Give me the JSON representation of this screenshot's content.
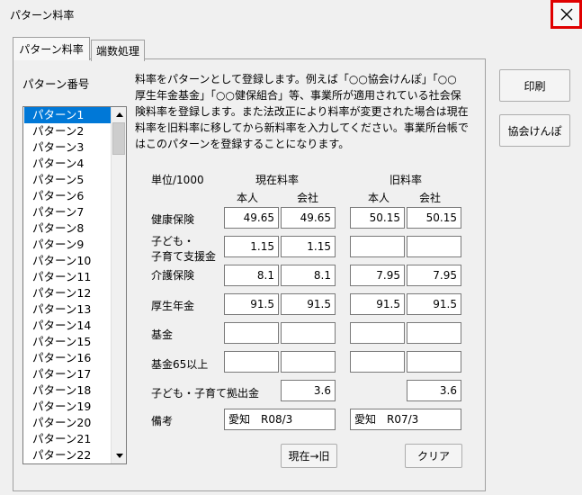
{
  "window": {
    "title": "パターン料率"
  },
  "tabs": [
    {
      "label": "パターン料率"
    },
    {
      "label": "端数処理"
    }
  ],
  "pattern_list": {
    "label": "パターン番号",
    "items": [
      "パターン1",
      "パターン2",
      "パターン3",
      "パターン4",
      "パターン5",
      "パターン6",
      "パターン7",
      "パターン8",
      "パターン9",
      "パターン10",
      "パターン11",
      "パターン12",
      "パターン13",
      "パターン14",
      "パターン15",
      "パターン16",
      "パターン17",
      "パターン18",
      "パターン19",
      "パターン20",
      "パターン21",
      "パターン22"
    ],
    "selected": "パターン1"
  },
  "description": [
    "料率をパターンとして登録します。例えば「○○協会けんぽ」「○○",
    "厚生年金基金」「○○健保組合」等、事業所が適用されている社会保",
    "険料率を登録します。また法改正により料率が変更された場合は現在",
    "料率を旧料率に移してから新料率を入力してください。事業所台帳で",
    "はこのパターンを登録することになります。"
  ],
  "rates": {
    "unit": "単位/1000",
    "current_header": "現在料率",
    "old_header": "旧料率",
    "person_label": "本人",
    "company_label": "会社",
    "rows": {
      "health": {
        "label": "健康保険",
        "cur_person": "49.65",
        "cur_company": "49.65",
        "old_person": "50.15",
        "old_company": "50.15"
      },
      "child": {
        "label_line1": "子ども・",
        "label_line2": "子育て支援金",
        "cur_person": "1.15",
        "cur_company": "1.15",
        "old_person": "",
        "old_company": ""
      },
      "care": {
        "label": "介護保険",
        "cur_person": "8.1",
        "cur_company": "8.1",
        "old_person": "7.95",
        "old_company": "7.95"
      },
      "pension": {
        "label": "厚生年金",
        "cur_person": "91.5",
        "cur_company": "91.5",
        "old_person": "91.5",
        "old_company": "91.5"
      },
      "fund": {
        "label": "基金",
        "cur_person": "",
        "cur_company": "",
        "old_person": "",
        "old_company": ""
      },
      "fund65": {
        "label": "基金65以上",
        "cur_person": "",
        "cur_company": "",
        "old_person": "",
        "old_company": ""
      }
    },
    "child_contribution": {
      "label": "子ども・子育て拠出金",
      "current": "3.6",
      "old": "3.6"
    },
    "remarks": {
      "label": "備考",
      "current": "愛知　R08/3",
      "old": "愛知　R07/3"
    }
  },
  "buttons": {
    "copy_current_to_old": "現在→旧",
    "clear": "クリア",
    "print": "印刷",
    "kyokai_kenpo": "協会けんぽ"
  }
}
